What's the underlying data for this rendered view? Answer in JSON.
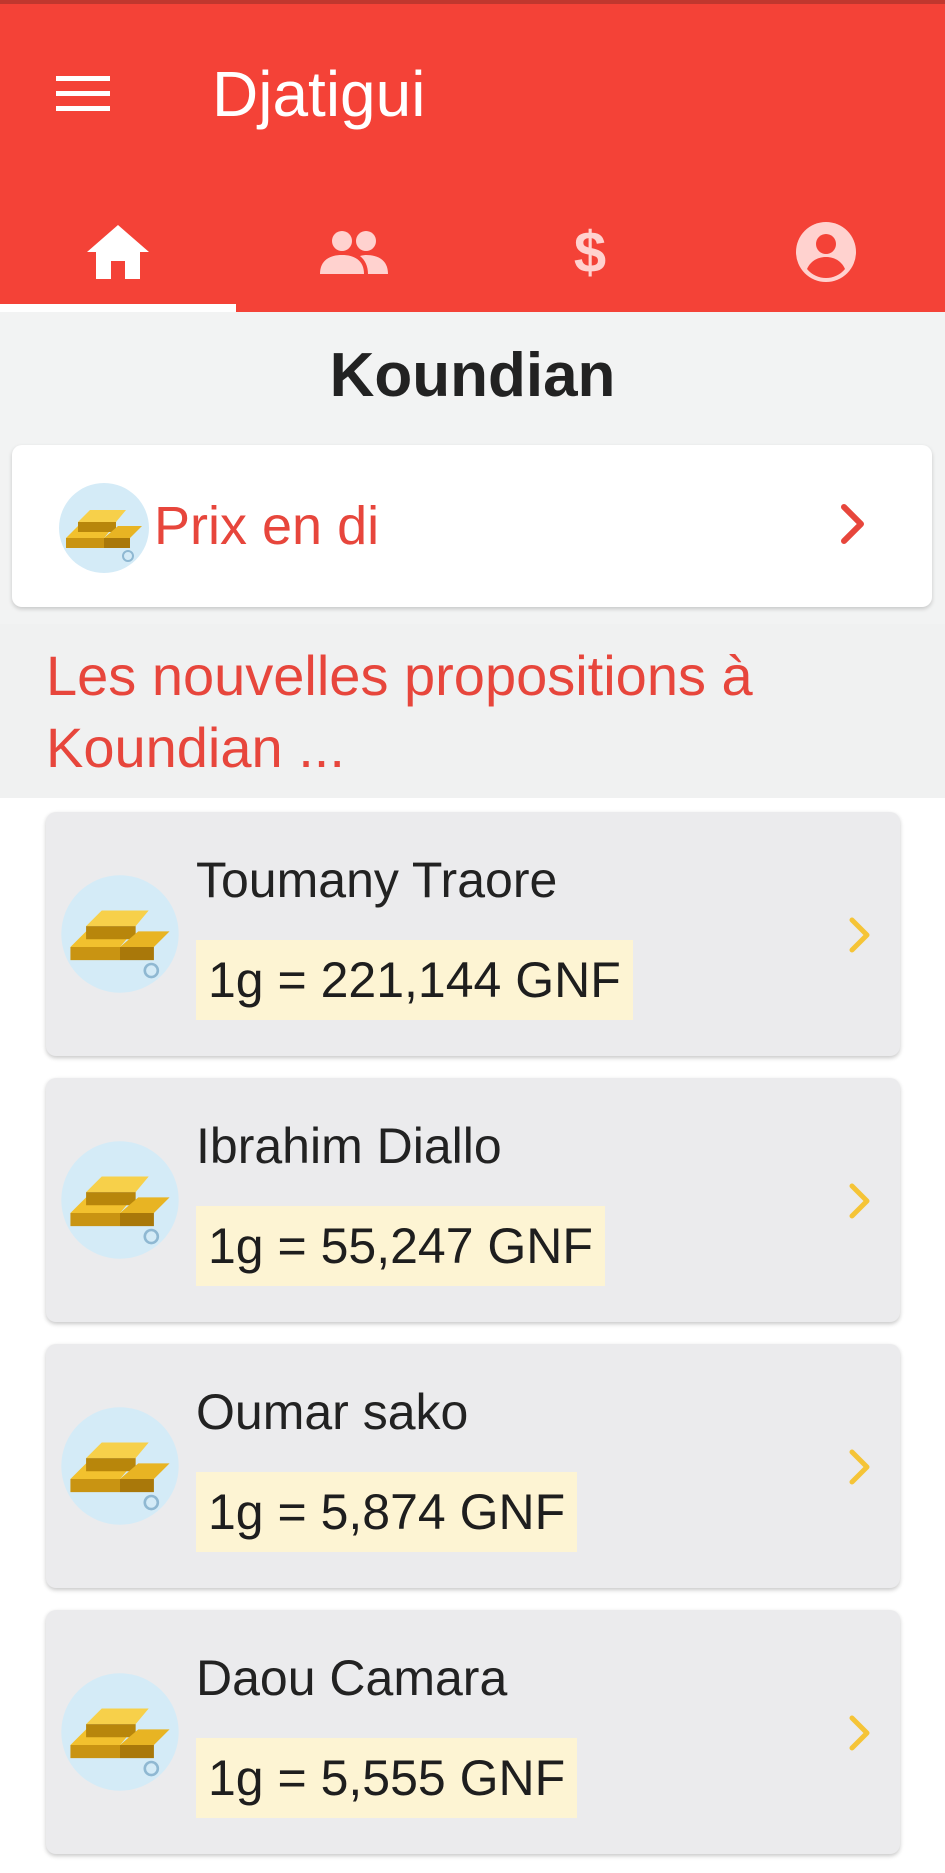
{
  "app": {
    "title": "Djatigui",
    "menu_icon": "menu-icon",
    "brand_color": "#f44237"
  },
  "tabs": [
    {
      "icon": "home-icon",
      "active": true
    },
    {
      "icon": "people-icon",
      "active": false
    },
    {
      "icon": "dollar-icon",
      "active": false
    },
    {
      "icon": "account-icon",
      "active": false
    }
  ],
  "section": {
    "title": "Koundian"
  },
  "prix_card": {
    "label": "Prix en di",
    "icon": "gold-bars-icon",
    "chevron": "chevron-right-icon",
    "accent": "#e7463c"
  },
  "new_propositions": {
    "heading": "Les nouvelles propositions à Koundian ..."
  },
  "propositions": [
    {
      "name": "Toumany Traore",
      "price": "1g = 221,144 GNF"
    },
    {
      "name": "Ibrahim Diallo",
      "price": "1g = 55,247 GNF"
    },
    {
      "name": "Oumar sako",
      "price": "1g = 5,874 GNF"
    },
    {
      "name": "Daou Camara",
      "price": "1g = 5,555 GNF"
    }
  ]
}
